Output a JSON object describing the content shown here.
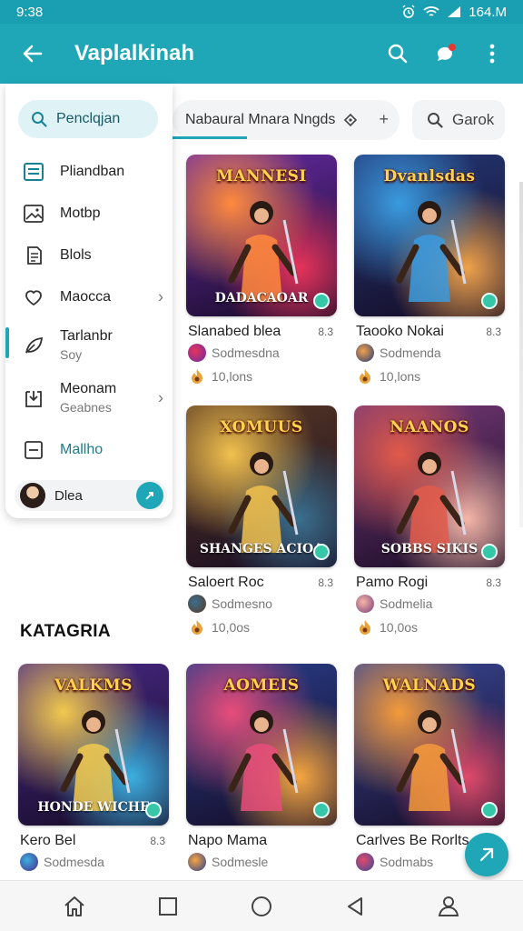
{
  "status_bar": {
    "time": "9:38",
    "network": "164.M"
  },
  "app_bar": {
    "title": "Vaplalkinah"
  },
  "filter": {
    "chip_label": "Nabaural Mnara Nngds",
    "search_label": "Garok"
  },
  "drawer": {
    "search_label": "Penclqjan",
    "items": [
      {
        "label": "Pliandban",
        "sub": ""
      },
      {
        "label": "Motbp",
        "sub": ""
      },
      {
        "label": "Blols",
        "sub": ""
      },
      {
        "label": "Maocca",
        "sub": ""
      },
      {
        "label": "Tarlanbr",
        "sub": "Soy"
      },
      {
        "label": "Meonam",
        "sub": "Geabnes"
      },
      {
        "label": "Mallho",
        "sub": ""
      }
    ],
    "user": {
      "name": "Dlea"
    }
  },
  "section_label": "KATAGRIA",
  "games": [
    {
      "art_title": "MANNESI",
      "art_bottom": "DADACAOAR",
      "name": "Slanabed blea",
      "rank": "8.3",
      "developer": "Sodmesdna",
      "downloads": "10,lons",
      "colors": [
        "#ff8a3d",
        "#6a2ca8",
        "#e7335a"
      ]
    },
    {
      "art_title": "Dvanlsdas",
      "art_bottom": "",
      "name": "Taooko Nokai",
      "rank": "8.3",
      "developer": "Sodmenda",
      "downloads": "10,lons",
      "colors": [
        "#3a9be0",
        "#253a7a",
        "#f0a24a"
      ]
    },
    {
      "art_title": "XOMUUS",
      "art_bottom": "SHANGES ACIOA",
      "name": "Saloert Roc",
      "rank": "8.3",
      "developer": "Sodmesno",
      "downloads": "10,0os",
      "colors": [
        "#f2c14e",
        "#5b3a24",
        "#3a6f8f"
      ]
    },
    {
      "art_title": "NAANOS",
      "art_bottom": "SOBBS SIKIS",
      "name": "Pamo Rogi",
      "rank": "8.3",
      "developer": "Sodmelia",
      "downloads": "10,0os",
      "colors": [
        "#e25a4a",
        "#7a3b7a",
        "#f5b6a8"
      ]
    },
    {
      "art_title": "VALKMS",
      "art_bottom": "HONDE WICHE",
      "name": "Kero Bel",
      "rank": "8.3",
      "developer": "Sodmesda",
      "downloads": "",
      "colors": [
        "#f2c94e",
        "#4a2a8a",
        "#3bb0e0"
      ]
    },
    {
      "art_title": "AOMEIS",
      "art_bottom": "",
      "name": "Napo Mama",
      "rank": "",
      "developer": "Sodmesle",
      "downloads": "",
      "colors": [
        "#e84d7a",
        "#2a3f8f",
        "#f6a640"
      ]
    },
    {
      "art_title": "WALNADS",
      "art_bottom": "",
      "name": "Carlves Be Rorlts",
      "rank": "",
      "developer": "Sodmabs",
      "downloads": "",
      "colors": [
        "#f59a3a",
        "#3a4a9a",
        "#e04a6a"
      ]
    }
  ]
}
